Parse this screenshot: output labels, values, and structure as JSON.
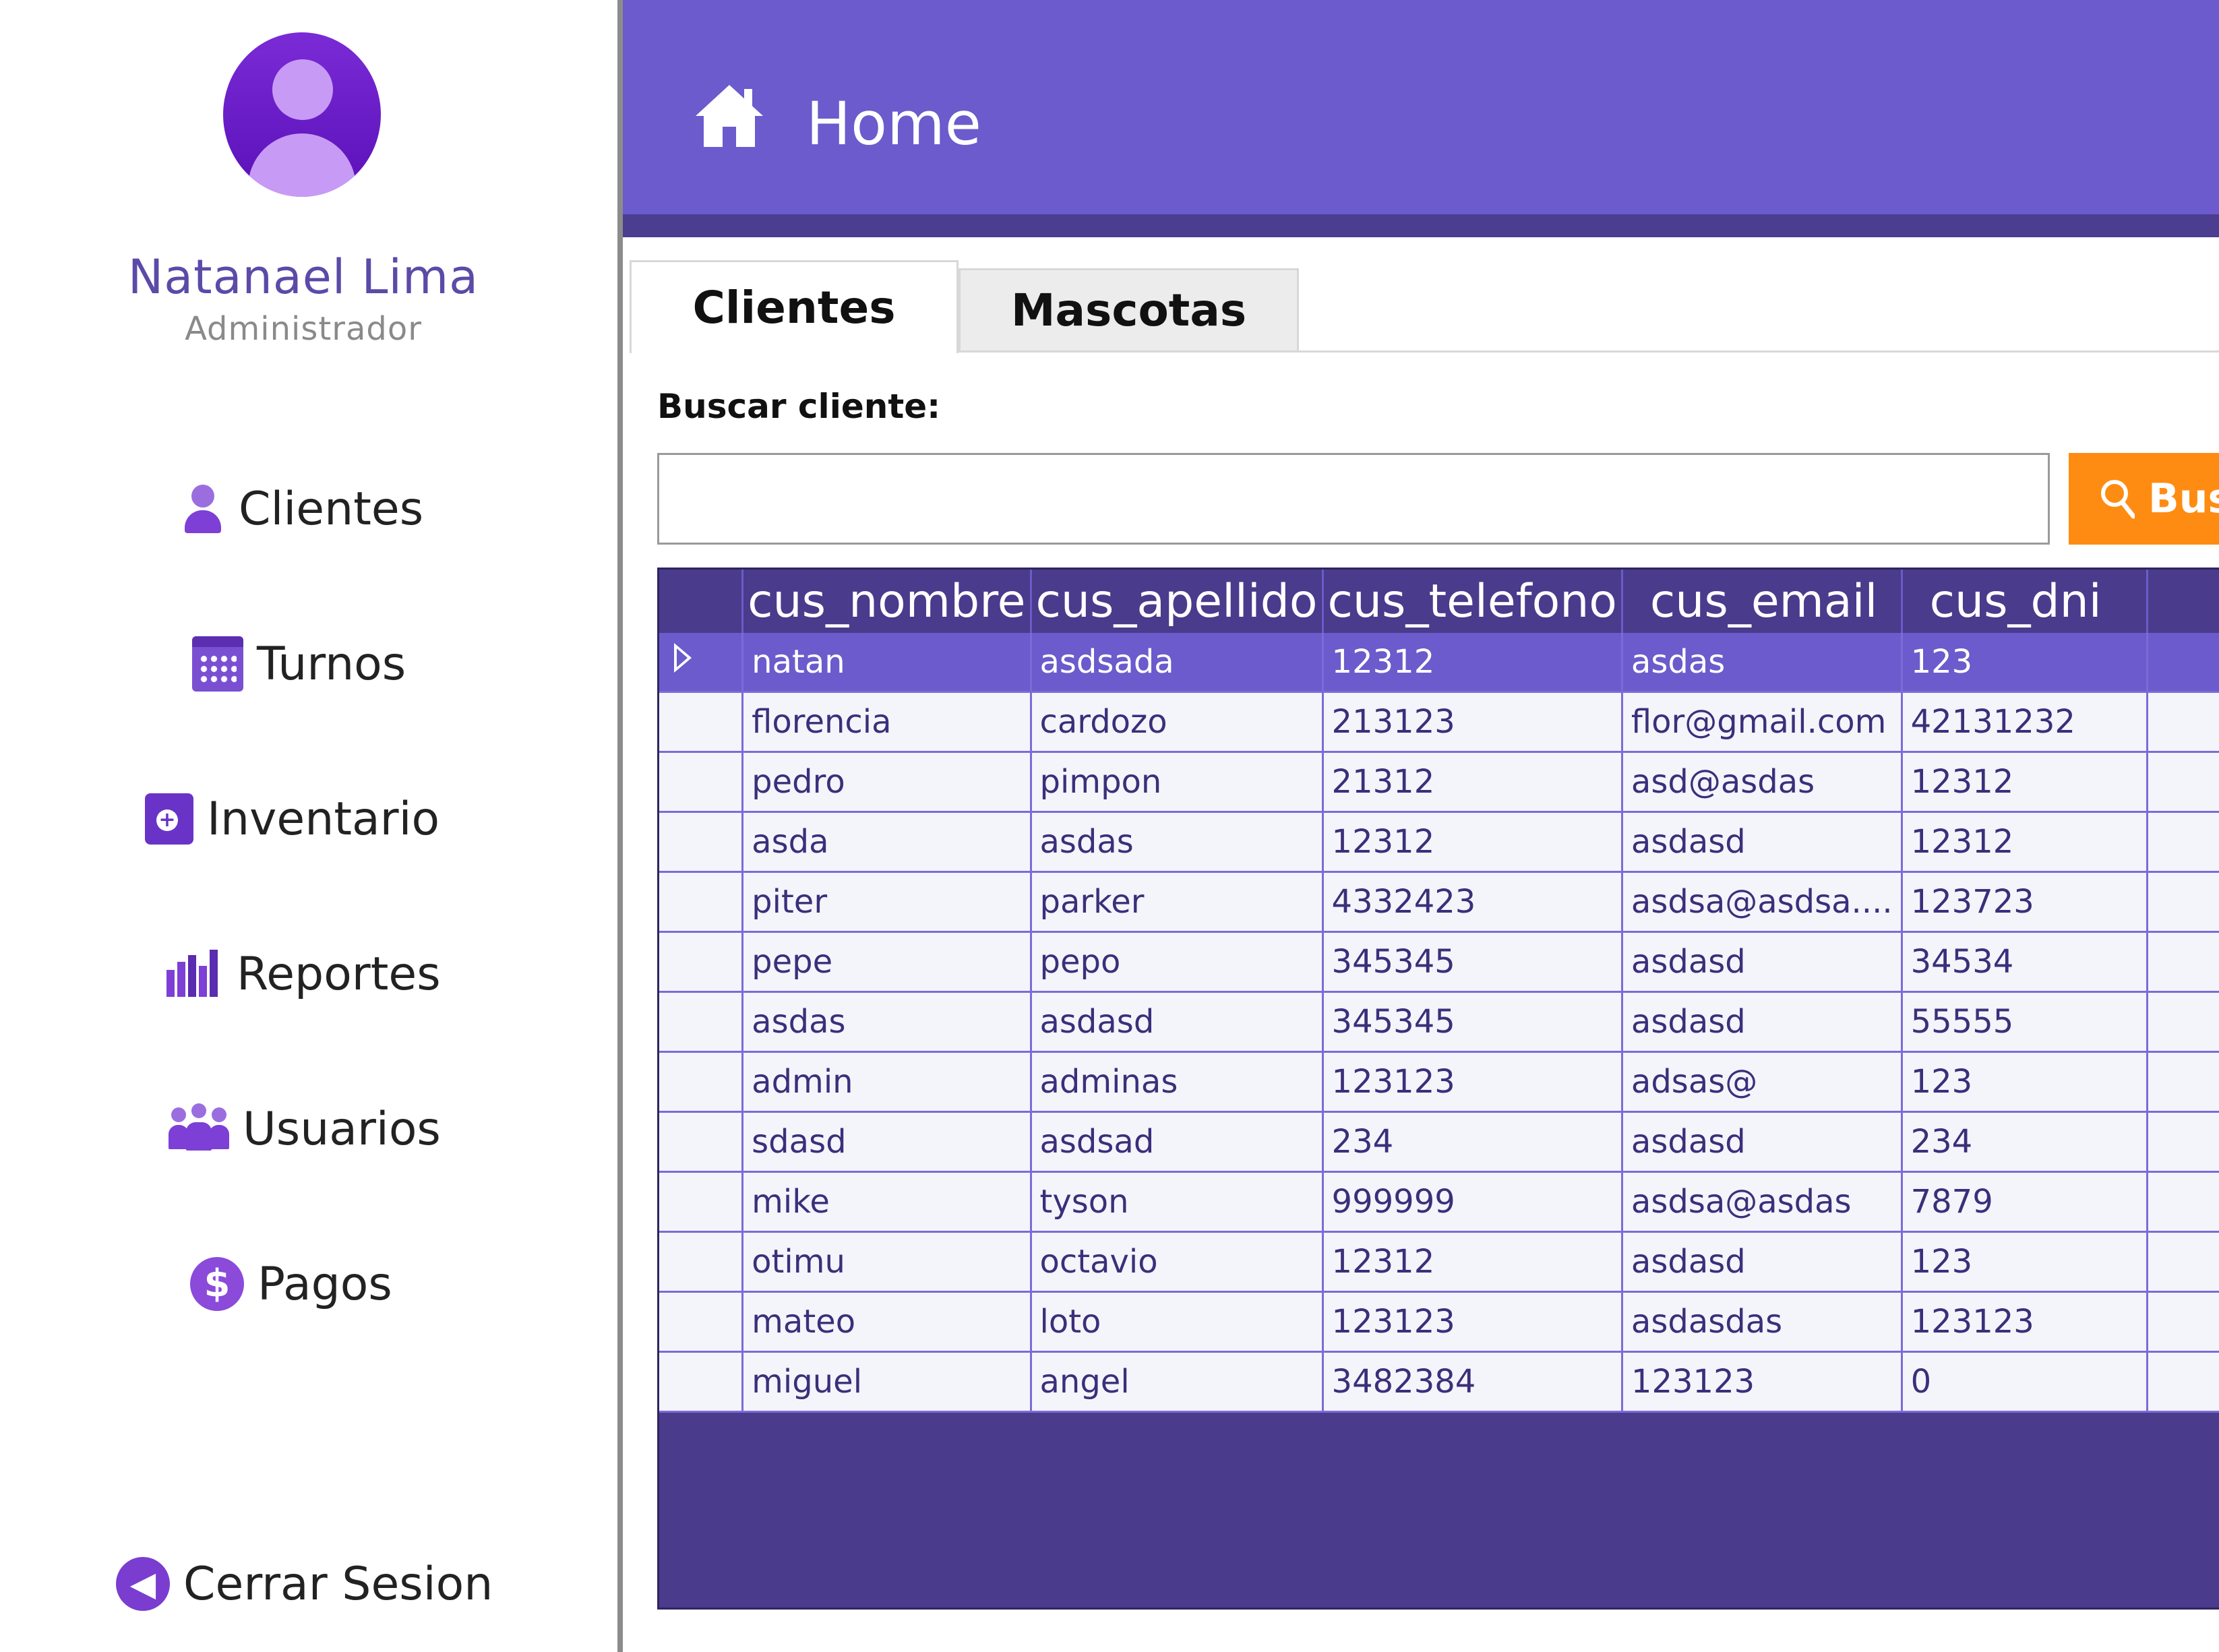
{
  "user": {
    "name": "Natanael Lima",
    "role": "Administrador"
  },
  "sidebar": {
    "items": [
      {
        "label": "Clientes",
        "icon": "user-icon"
      },
      {
        "label": "Turnos",
        "icon": "calendar-icon"
      },
      {
        "label": "Inventario",
        "icon": "medical-case-icon"
      },
      {
        "label": "Reportes",
        "icon": "bar-chart-icon"
      },
      {
        "label": "Usuarios",
        "icon": "users-group-icon"
      },
      {
        "label": "Pagos",
        "icon": "dollar-icon"
      }
    ],
    "logout_label": "Cerrar Sesion"
  },
  "header": {
    "title": "Home",
    "icon": "home-icon",
    "color": "#6b5bcc"
  },
  "tabs": [
    {
      "label": "Clientes",
      "active": true
    },
    {
      "label": "Mascotas",
      "active": false
    }
  ],
  "search": {
    "label": "Buscar cliente:",
    "value": "",
    "button_label": "Bus"
  },
  "grid": {
    "columns": [
      "cus_nombre",
      "cus_apellido",
      "cus_telefono",
      "cus_email",
      "cus_dni"
    ],
    "selected_row": 0,
    "rows": [
      [
        "natan",
        "asdsada",
        "12312",
        "asdas",
        "123"
      ],
      [
        "florencia",
        "cardozo",
        "213123",
        "flor@gmail.com",
        "42131232"
      ],
      [
        "pedro",
        "pimpon",
        "21312",
        "asd@asdas",
        "12312"
      ],
      [
        "asda",
        "asdas",
        "12312",
        "asdasd",
        "12312"
      ],
      [
        "piter",
        "parker",
        "4332423",
        "asdsa@asdsa....",
        "123723"
      ],
      [
        "pepe",
        "pepo",
        "345345",
        "asdasd",
        "34534"
      ],
      [
        "asdas",
        "asdasd",
        "345345",
        "asdasd",
        "55555"
      ],
      [
        "admin",
        "adminas",
        "123123",
        "adsas@",
        "123"
      ],
      [
        "sdasd",
        "asdsad",
        "234",
        "asdasd",
        "234"
      ],
      [
        "mike",
        "tyson",
        "999999",
        "asdsa@asdas",
        "7879"
      ],
      [
        "otimu",
        "octavio",
        "12312",
        "asdasd",
        "123"
      ],
      [
        "mateo",
        "loto",
        "123123",
        "asdasdas",
        "123123"
      ],
      [
        "miguel",
        "angel",
        "3482384",
        "123123",
        "0"
      ]
    ]
  },
  "colors": {
    "accent": "#6b5bcc",
    "dark": "#4a3b8c",
    "button": "#ff8c12"
  }
}
